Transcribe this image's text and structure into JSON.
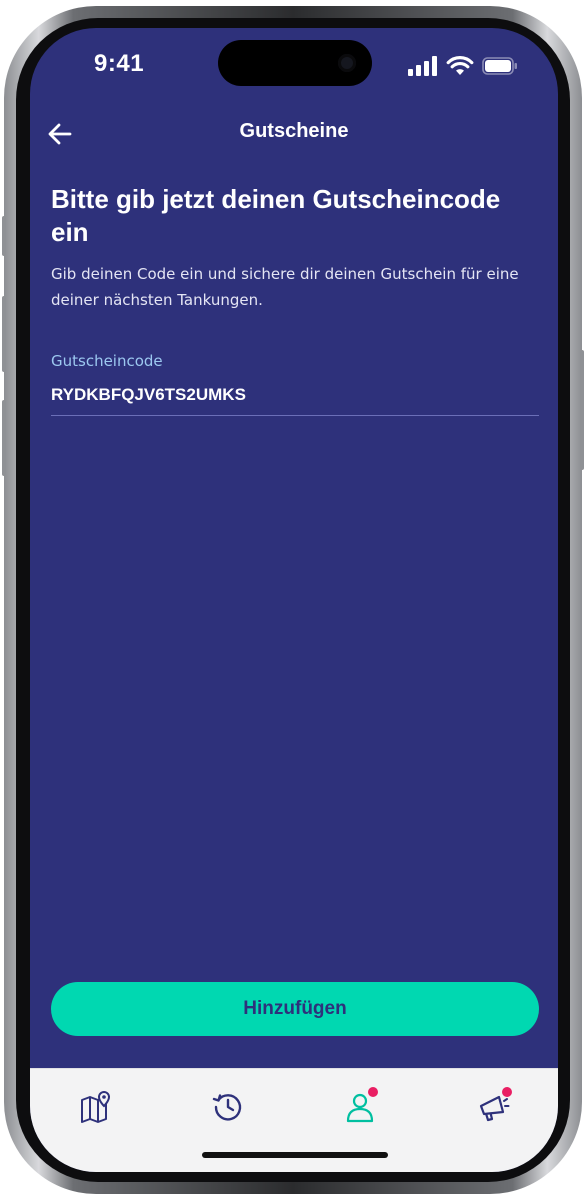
{
  "status_bar": {
    "time": "9:41",
    "icons": [
      "cellular-signal-icon",
      "wifi-icon",
      "battery-icon"
    ]
  },
  "header": {
    "title": "Gutscheine",
    "back_icon": "arrow-left-icon"
  },
  "main": {
    "heading": "Bitte gib jetzt deinen Gutscheincode ein",
    "description": "Gib deinen Code ein und sichere dir deinen Gutschein für eine deiner nächsten Tankungen.",
    "field": {
      "label": "Gutscheincode",
      "value": "RYDKBFQJV6TS2UMKS"
    },
    "submit_label": "Hinzufügen"
  },
  "tab_bar": {
    "items": [
      {
        "icon": "map-pin-icon",
        "badge": false
      },
      {
        "icon": "history-icon",
        "badge": false
      },
      {
        "icon": "profile-icon",
        "badge": true
      },
      {
        "icon": "megaphone-icon",
        "badge": true
      }
    ]
  },
  "colors": {
    "background": "#2e317b",
    "accent": "#00d8b1",
    "label": "#9cc8f0",
    "badge": "#e91e63",
    "tab_bar": "#f3f3f4"
  }
}
